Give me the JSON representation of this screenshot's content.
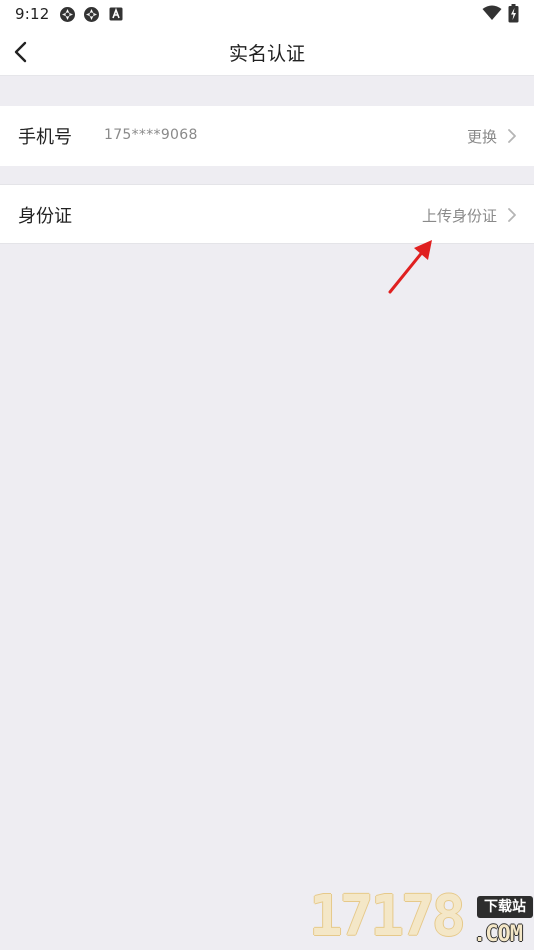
{
  "status_bar": {
    "time": "9:12",
    "icons": [
      "app-notification-icon",
      "app-notification-icon",
      "a-notification-icon",
      "wifi-icon",
      "battery-charging-icon"
    ]
  },
  "nav": {
    "title": "实名认证",
    "back_icon": "back-arrow-icon"
  },
  "rows": {
    "phone": {
      "label": "手机号",
      "value": "175****9068",
      "action": "更换"
    },
    "id_card": {
      "label": "身份证",
      "action": "上传身份证"
    }
  },
  "watermark": {
    "number": "17178",
    "badge": "下载站",
    "domain": ".COM"
  },
  "colors": {
    "background": "#eeedf2",
    "surface": "#ffffff",
    "text_primary": "#222222",
    "text_secondary": "#8a8a8a",
    "annotation": "#e02020"
  }
}
